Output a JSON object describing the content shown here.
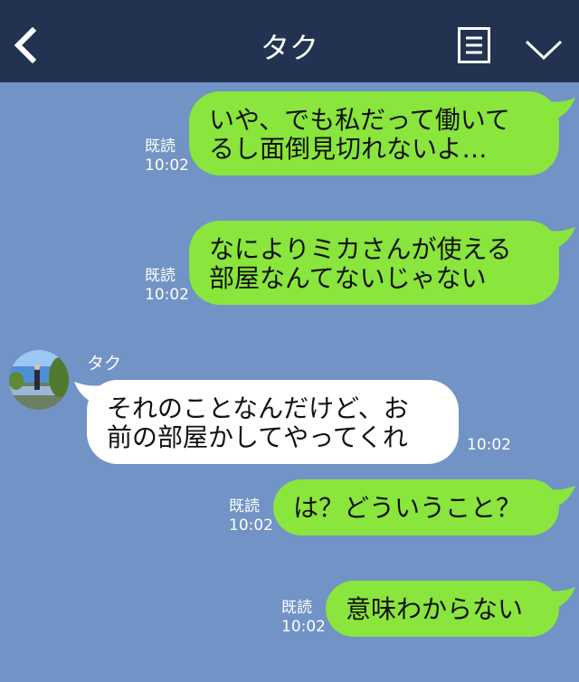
{
  "header": {
    "title": "タク"
  },
  "messages": [
    {
      "side": "right",
      "text": "いや、でも私だって働いて\nるし面倒見切れないよ…",
      "read": "既読",
      "time": "10:02"
    },
    {
      "side": "right",
      "text": "なによりミカさんが使える\n部屋なんてないじゃない",
      "read": "既読",
      "time": "10:02"
    },
    {
      "side": "left",
      "sender": "タク",
      "text": "それのことなんだけど、お\n前の部屋かしてやってくれ",
      "time": "10:02"
    },
    {
      "side": "right",
      "text": "は？どういうこと？",
      "read": "既読",
      "time": "10:02"
    },
    {
      "side": "right",
      "text": "意味わからない",
      "read": "既読",
      "time": "10:02"
    }
  ],
  "colors": {
    "header_bg": "#223351",
    "chat_bg": "#7193c5",
    "outgoing_bubble": "#8ae53c",
    "incoming_bubble": "#ffffff"
  },
  "icons": {
    "back": "chevron-left-icon",
    "menu": "notes-menu-icon",
    "collapse": "chevron-down-icon"
  }
}
